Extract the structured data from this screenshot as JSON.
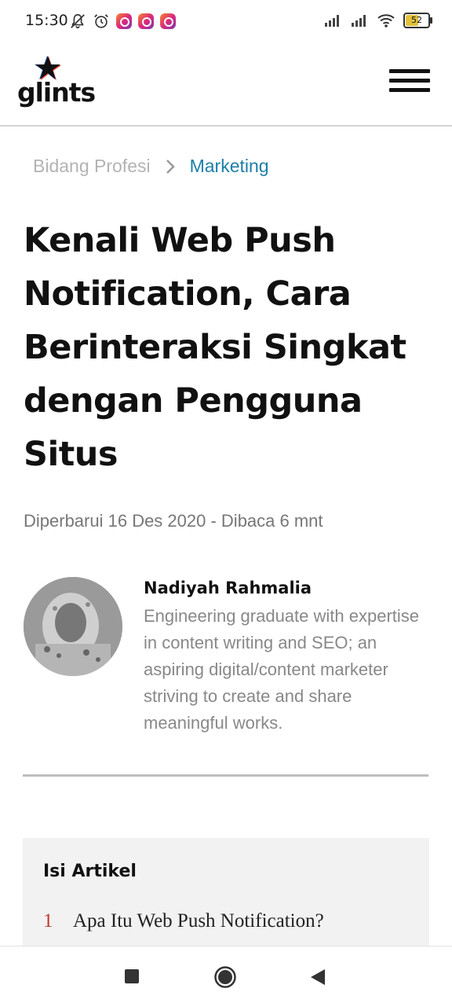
{
  "status_bar": {
    "time": "15:30",
    "battery": "52"
  },
  "header": {
    "logo_text": "glints"
  },
  "breadcrumb": {
    "items": [
      "Bidang Profesi",
      "Marketing"
    ],
    "separator": ">"
  },
  "article": {
    "title": "Kenali Web Push Notification, Cara Berinteraksi Singkat dengan Pengguna Situs",
    "meta": "Diperbarui 16 Des 2020 - Dibaca 6 mnt"
  },
  "author": {
    "name": "Nadiyah Rahmalia",
    "bio": "Engineering graduate with expertise in content writing and SEO; an aspiring digital/content marketer striving to create and share meaningful works."
  },
  "toc": {
    "title": "Isi Artikel",
    "items": [
      {
        "num": "1",
        "text": "Apa Itu Web Push Notification?"
      }
    ]
  },
  "colors": {
    "breadcrumb_active": "#1d7ea8",
    "toc_number": "#c0392b",
    "logo_star": "#111111"
  },
  "icons": {
    "status_left": [
      "notification-off-icon",
      "alarm-icon",
      "instagram-icon",
      "instagram-icon",
      "instagram-icon"
    ],
    "status_right": [
      "signal-icon",
      "signal-icon",
      "wifi-icon",
      "battery-icon"
    ],
    "nav": [
      "recents-icon",
      "home-icon",
      "back-icon"
    ]
  }
}
